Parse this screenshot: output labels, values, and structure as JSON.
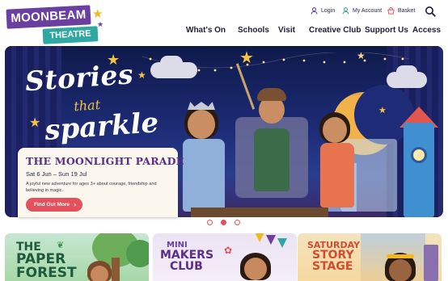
{
  "logo": {
    "line1": "MOONBEAM",
    "line2": "THEATRE"
  },
  "utility": {
    "login": "Login",
    "account": "My Account",
    "basket": "Basket"
  },
  "nav": [
    {
      "label": "What's On",
      "has_dropdown": true
    },
    {
      "label": "Schools",
      "has_dropdown": true
    },
    {
      "label": "Visit",
      "has_dropdown": true
    },
    {
      "label": "Creative Club",
      "has_dropdown": true
    },
    {
      "label": "Support Us",
      "has_dropdown": true
    },
    {
      "label": "Access",
      "has_dropdown": true
    }
  ],
  "hero": {
    "title_line1": "Stories",
    "title_line2": "that",
    "title_line3": "sparkle",
    "event": {
      "title": "THE MOONLIGHT PARADE",
      "dates": "Sat 6 Jun – Sun 19 Jul",
      "description": "A joyful new adventure for ages 3+ about courage, friendship and believing in magic.",
      "cta": "Find Out More"
    },
    "carousel": {
      "slides": 3,
      "active": 2
    }
  },
  "promos": [
    {
      "line1": "THE",
      "line2": "PAPER",
      "line3": "FOREST"
    },
    {
      "line1": "MINI",
      "line2": "MAKERS",
      "line3": "CLUB"
    },
    {
      "line1": "SATURDAY",
      "line2": "STORY",
      "line3": "STAGE"
    }
  ],
  "colors": {
    "brand_purple": "#6a3fa0",
    "brand_teal": "#2fa8a3",
    "accent_red": "#e4505b",
    "star_yellow": "#f5c542"
  },
  "icons": {
    "login": "person-icon",
    "account": "account-icon",
    "basket": "basket-icon",
    "search": "search-icon"
  }
}
